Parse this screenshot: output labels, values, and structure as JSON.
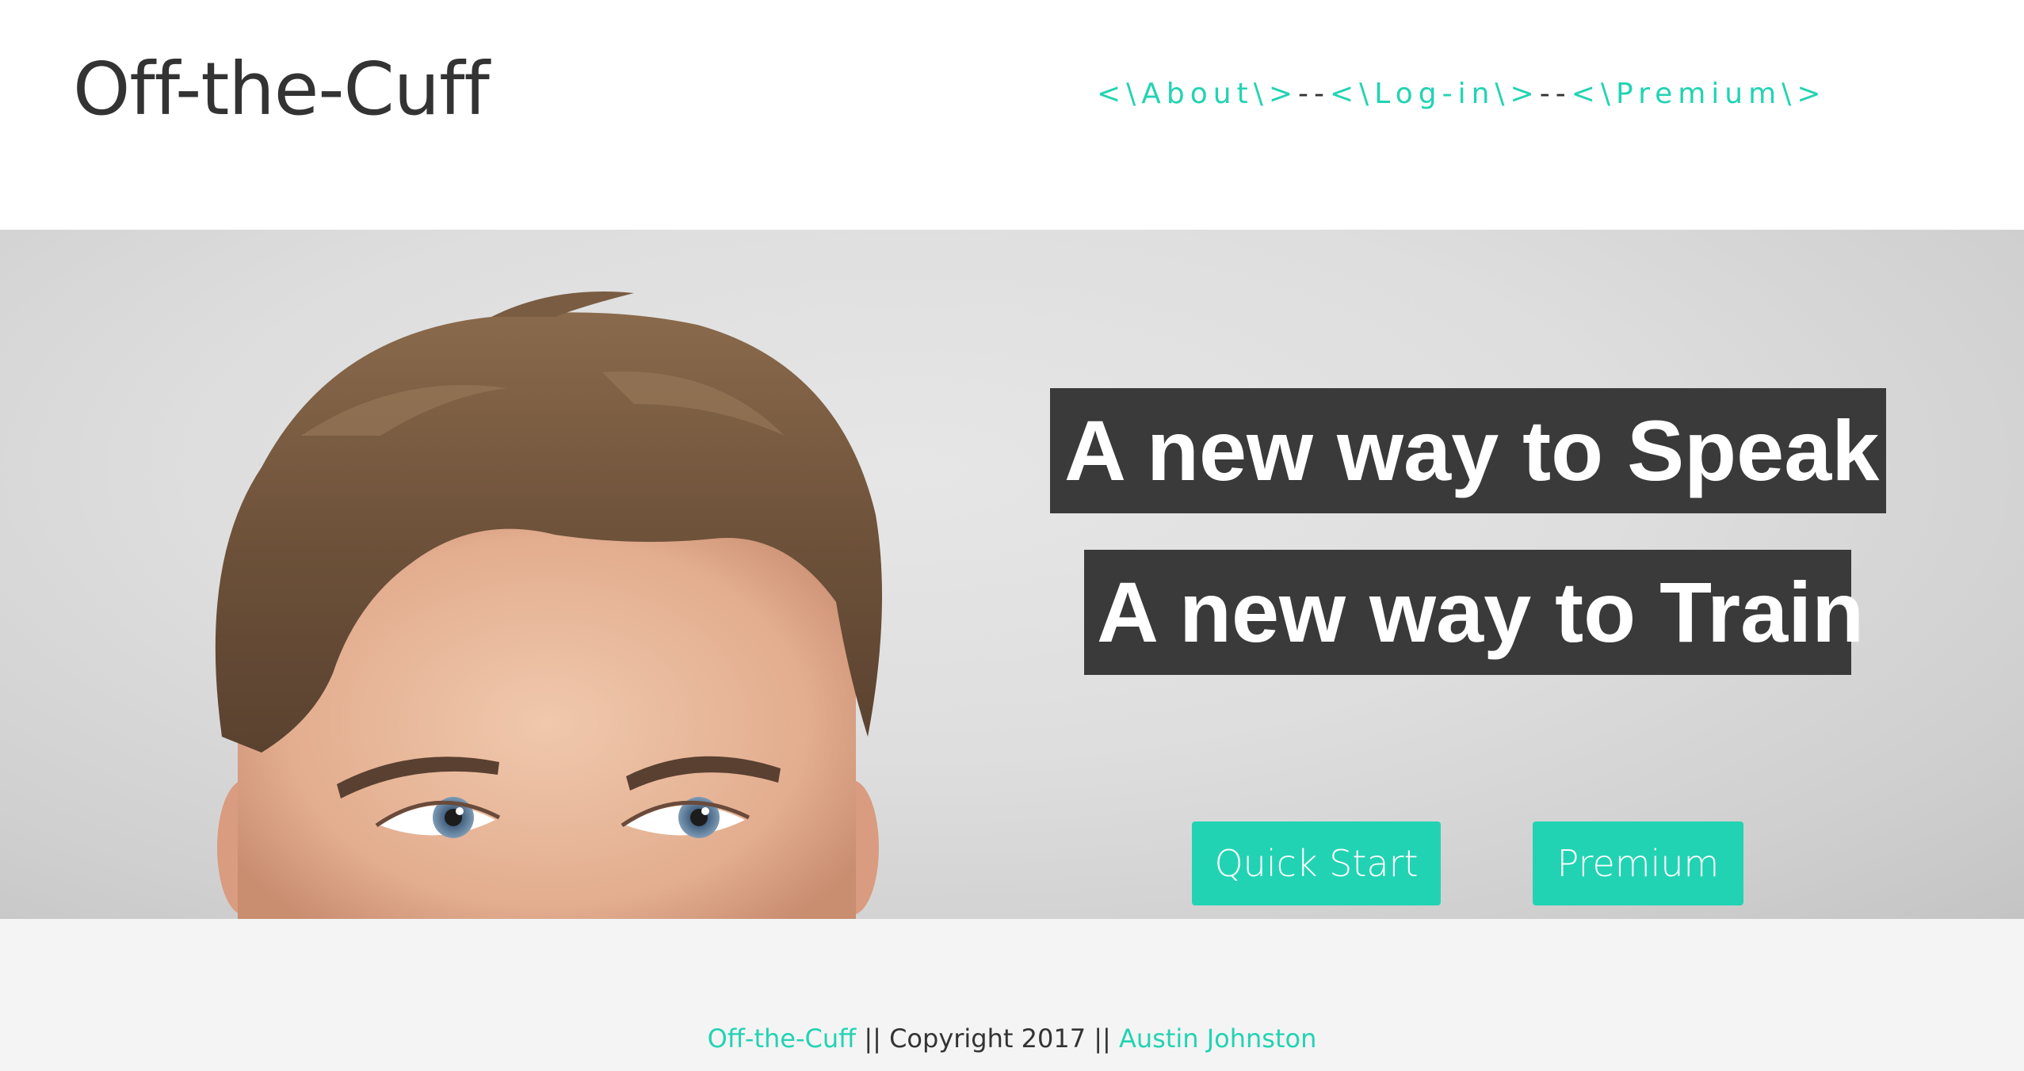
{
  "header": {
    "logo": "Off-the-Cuff",
    "nav": {
      "about": "<\\About\\>",
      "sep1": "--",
      "login": "<\\Log-in\\>",
      "sep2": "--",
      "premium": "<\\Premium\\>"
    }
  },
  "hero": {
    "headline_1": "A new way to Speak",
    "headline_2": "A new way to Train",
    "quick_start_label": "Quick Start",
    "premium_label": "Premium",
    "image_icon": "man-looking-up-photo"
  },
  "footer": {
    "brand": "Off-the-Cuff",
    "sep1": " || ",
    "copyright": "Copyright 2017",
    "sep2": " || ",
    "author": "Austin Johnston"
  },
  "colors": {
    "accent": "#22d3b3",
    "headline_bg": "#3a3a3a",
    "text_dark": "#333333",
    "footer_bg": "#f4f4f4"
  }
}
